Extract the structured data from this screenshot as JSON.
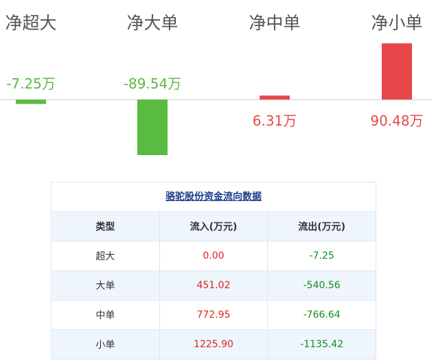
{
  "chart_data": {
    "type": "bar",
    "categories": [
      "净超大",
      "净大单",
      "净中单",
      "净小单"
    ],
    "values": [
      -7.25,
      -89.54,
      6.31,
      90.48
    ],
    "value_labels": [
      "-7.25万",
      "-89.54万",
      "6.31万",
      "90.48万"
    ],
    "unit": "万",
    "colors": {
      "positive": "#e8474a",
      "negative": "#5abb41",
      "baseline": "#cccccc"
    }
  },
  "table": {
    "title": "骆驼股份资金流向数据",
    "headers": [
      "类型",
      "流入(万元)",
      "流出(万元)"
    ],
    "rows": [
      {
        "type": "超大",
        "inflow": "0.00",
        "outflow": "-7.25"
      },
      {
        "type": "大单",
        "inflow": "451.02",
        "outflow": "-540.56"
      },
      {
        "type": "中单",
        "inflow": "772.95",
        "outflow": "-766.64"
      },
      {
        "type": "小单",
        "inflow": "1225.90",
        "outflow": "-1135.42"
      }
    ]
  }
}
